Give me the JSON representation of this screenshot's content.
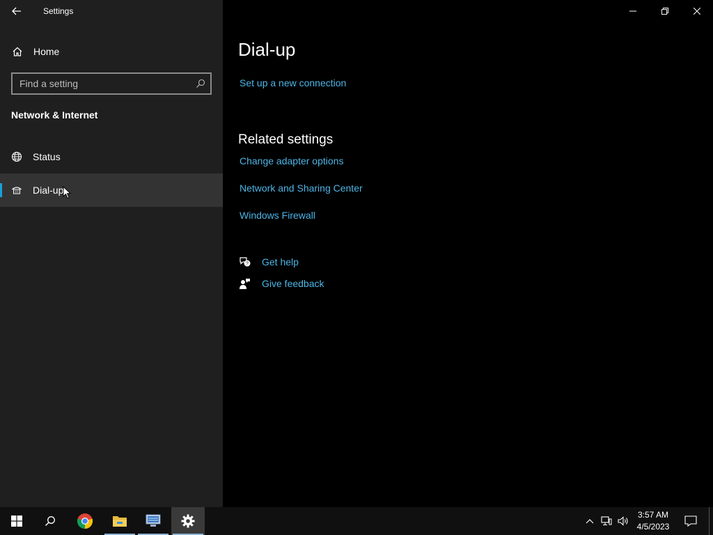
{
  "window": {
    "app_title": "Settings",
    "controls": [
      "minimize",
      "restore",
      "close"
    ]
  },
  "sidebar": {
    "home_label": "Home",
    "search_placeholder": "Find a setting",
    "section_title": "Network & Internet",
    "items": [
      {
        "label": "Status",
        "icon": "globe-icon",
        "selected": false
      },
      {
        "label": "Dial-up",
        "icon": "dial-up-icon",
        "selected": true
      }
    ]
  },
  "main": {
    "title": "Dial-up",
    "setup_link": "Set up a new connection",
    "related_title": "Related settings",
    "related_links": [
      "Change adapter options",
      "Network and Sharing Center",
      "Windows Firewall"
    ],
    "help": {
      "get_help": "Get help",
      "give_feedback": "Give feedback"
    }
  },
  "taskbar": {
    "pinned": [
      "start-icon",
      "search-icon",
      "chrome-icon",
      "file-explorer-icon",
      "network-app-icon",
      "settings-icon"
    ],
    "active": "settings-icon",
    "time": "3:57 AM",
    "date": "4/5/2023"
  },
  "colors": {
    "accent_link": "#4cb5e6",
    "selection_bar": "#1aa0d8",
    "sidebar_bg": "#1f1f1f",
    "selected_bg": "#333333",
    "content_bg": "#000000",
    "taskbar_bg": "#101010"
  }
}
